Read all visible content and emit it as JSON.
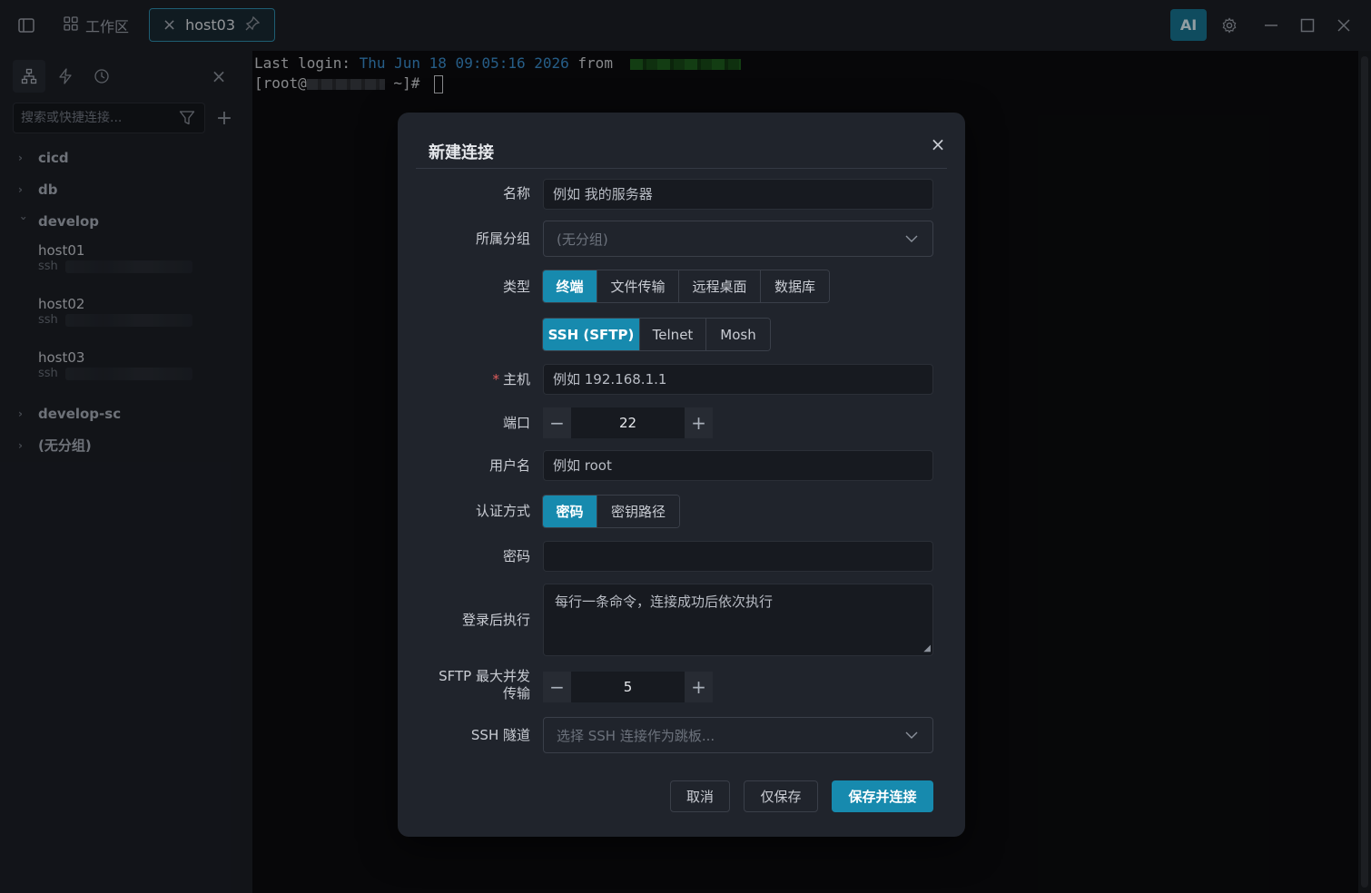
{
  "titlebar": {
    "workspace_tab": "工作区",
    "active_tab": "host03",
    "ai_label": "AI"
  },
  "sidebar": {
    "search_placeholder": "搜索或快捷连接...",
    "groups": [
      {
        "name": "cicd",
        "expanded": false
      },
      {
        "name": "db",
        "expanded": false
      },
      {
        "name": "develop",
        "expanded": true,
        "hosts": [
          {
            "name": "host01",
            "protocol": "ssh"
          },
          {
            "name": "host02",
            "protocol": "ssh"
          },
          {
            "name": "host03",
            "protocol": "ssh"
          }
        ]
      },
      {
        "name": "develop-sc",
        "expanded": false
      },
      {
        "name": "(无分组)",
        "expanded": false
      }
    ]
  },
  "terminal": {
    "line1_prefix": "Last login: ",
    "line1_date": "Thu Jun 18 09:05:16 2026",
    "line1_from": " from ",
    "line2_prefix": "[root@",
    "line2_suffix": " ~]# "
  },
  "dialog": {
    "title": "新建连接",
    "labels": {
      "name": "名称",
      "group": "所属分组",
      "type": "类型",
      "host_required": "*",
      "host": "主机",
      "port": "端口",
      "username": "用户名",
      "auth": "认证方式",
      "password": "密码",
      "post_login": "登录后执行",
      "sftp_concurrency_1": "SFTP 最大并发",
      "sftp_concurrency_2": "传输",
      "ssh_tunnel": "SSH 隧道"
    },
    "name_placeholder": "例如 我的服务器",
    "group_value": "(无分组)",
    "types": [
      "终端",
      "文件传输",
      "远程桌面",
      "数据库"
    ],
    "types_selected": "终端",
    "protocols": [
      "SSH (SFTP)",
      "Telnet",
      "Mosh"
    ],
    "protocols_selected": "SSH (SFTP)",
    "host_placeholder": "例如 192.168.1.1",
    "port_value": "22",
    "username_placeholder": "例如 root",
    "auth_methods": [
      "密码",
      "密钥路径"
    ],
    "auth_selected": "密码",
    "password_value": "",
    "post_login_placeholder": "每行一条命令，连接成功后依次执行",
    "sftp_concurrency_value": "5",
    "ssh_tunnel_placeholder": "选择 SSH 连接作为跳板...",
    "buttons": {
      "cancel": "取消",
      "save_only": "仅保存",
      "save_connect": "保存并连接"
    }
  },
  "colors": {
    "accent": "#178aae",
    "ai_button": "#177693",
    "required": "#e05d5d",
    "terminal_date": "#3b8fd0"
  }
}
